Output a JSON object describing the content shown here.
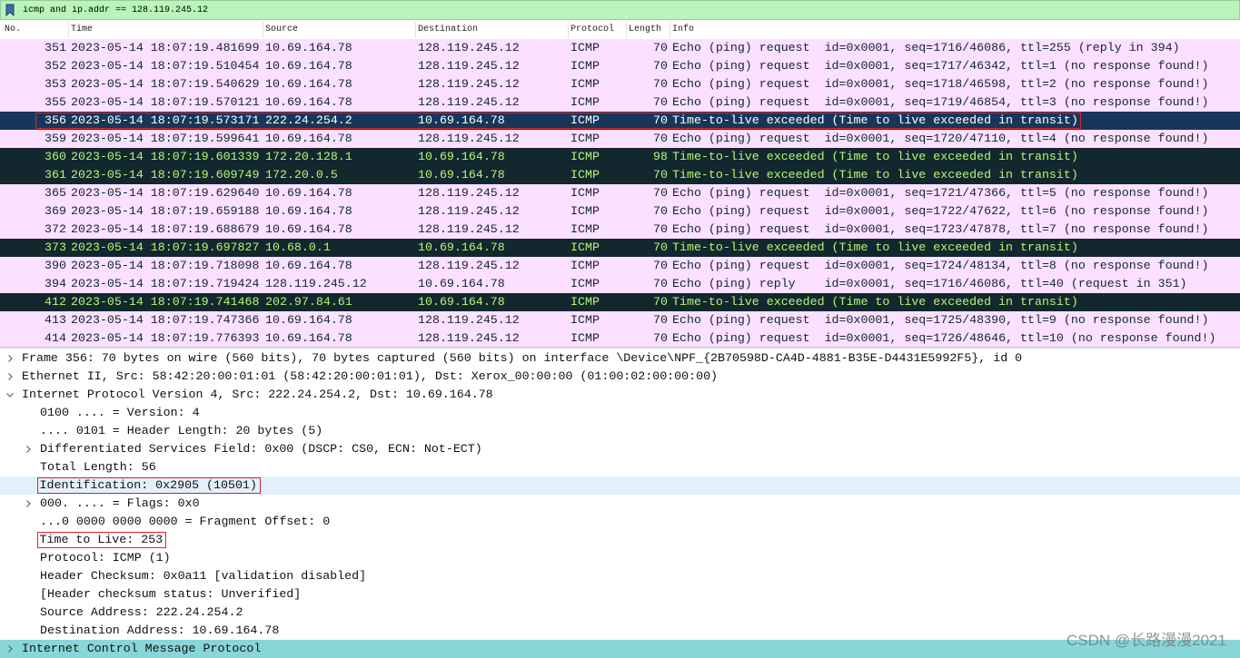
{
  "filter": {
    "icon": "bookmark-icon",
    "value": "icmp and ip.addr == 128.119.245.12",
    "bg": "#b9f5b9"
  },
  "columns": {
    "no": "No.",
    "time": "Time",
    "source": "Source",
    "destination": "Destination",
    "protocol": "Protocol",
    "length": "Length",
    "info": "Info"
  },
  "coloring_rules": {
    "icmp": {
      "bg": "#fce0ff",
      "fg": "#12272e"
    },
    "icmp_errors": {
      "bg": "#12272e",
      "fg": "#b7f774"
    },
    "selected": {
      "bg": "#18365a",
      "fg": "#ffffff"
    }
  },
  "packets": [
    {
      "no": "351",
      "time": "2023-05-14 18:07:19.481699",
      "source": "10.69.164.78",
      "destination": "128.119.245.12",
      "protocol": "ICMP",
      "length": "70",
      "info": "Echo (ping) request  id=0x0001, seq=1716/46086, ttl=255 (reply in 394)",
      "error": false
    },
    {
      "no": "352",
      "time": "2023-05-14 18:07:19.510454",
      "source": "10.69.164.78",
      "destination": "128.119.245.12",
      "protocol": "ICMP",
      "length": "70",
      "info": "Echo (ping) request  id=0x0001, seq=1717/46342, ttl=1 (no response found!)",
      "error": false
    },
    {
      "no": "353",
      "time": "2023-05-14 18:07:19.540629",
      "source": "10.69.164.78",
      "destination": "128.119.245.12",
      "protocol": "ICMP",
      "length": "70",
      "info": "Echo (ping) request  id=0x0001, seq=1718/46598, ttl=2 (no response found!)",
      "error": false
    },
    {
      "no": "355",
      "time": "2023-05-14 18:07:19.570121",
      "source": "10.69.164.78",
      "destination": "128.119.245.12",
      "protocol": "ICMP",
      "length": "70",
      "info": "Echo (ping) request  id=0x0001, seq=1719/46854, ttl=3 (no response found!)",
      "error": false
    },
    {
      "no": "356",
      "time": "2023-05-14 18:07:19.573171",
      "source": "222.24.254.2",
      "destination": "10.69.164.78",
      "protocol": "ICMP",
      "length": "70",
      "info": "Time-to-live exceeded (Time to live exceeded in transit)",
      "error": true,
      "selected": true,
      "boxed": true
    },
    {
      "no": "359",
      "time": "2023-05-14 18:07:19.599641",
      "source": "10.69.164.78",
      "destination": "128.119.245.12",
      "protocol": "ICMP",
      "length": "70",
      "info": "Echo (ping) request  id=0x0001, seq=1720/47110, ttl=4 (no response found!)",
      "error": false
    },
    {
      "no": "360",
      "time": "2023-05-14 18:07:19.601339",
      "source": "172.20.128.1",
      "destination": "10.69.164.78",
      "protocol": "ICMP",
      "length": "98",
      "info": "Time-to-live exceeded (Time to live exceeded in transit)",
      "error": true
    },
    {
      "no": "361",
      "time": "2023-05-14 18:07:19.609749",
      "source": "172.20.0.5",
      "destination": "10.69.164.78",
      "protocol": "ICMP",
      "length": "70",
      "info": "Time-to-live exceeded (Time to live exceeded in transit)",
      "error": true
    },
    {
      "no": "365",
      "time": "2023-05-14 18:07:19.629640",
      "source": "10.69.164.78",
      "destination": "128.119.245.12",
      "protocol": "ICMP",
      "length": "70",
      "info": "Echo (ping) request  id=0x0001, seq=1721/47366, ttl=5 (no response found!)",
      "error": false
    },
    {
      "no": "369",
      "time": "2023-05-14 18:07:19.659188",
      "source": "10.69.164.78",
      "destination": "128.119.245.12",
      "protocol": "ICMP",
      "length": "70",
      "info": "Echo (ping) request  id=0x0001, seq=1722/47622, ttl=6 (no response found!)",
      "error": false
    },
    {
      "no": "372",
      "time": "2023-05-14 18:07:19.688679",
      "source": "10.69.164.78",
      "destination": "128.119.245.12",
      "protocol": "ICMP",
      "length": "70",
      "info": "Echo (ping) request  id=0x0001, seq=1723/47878, ttl=7 (no response found!)",
      "error": false
    },
    {
      "no": "373",
      "time": "2023-05-14 18:07:19.697827",
      "source": "10.68.0.1",
      "destination": "10.69.164.78",
      "protocol": "ICMP",
      "length": "70",
      "info": "Time-to-live exceeded (Time to live exceeded in transit)",
      "error": true
    },
    {
      "no": "390",
      "time": "2023-05-14 18:07:19.718098",
      "source": "10.69.164.78",
      "destination": "128.119.245.12",
      "protocol": "ICMP",
      "length": "70",
      "info": "Echo (ping) request  id=0x0001, seq=1724/48134, ttl=8 (no response found!)",
      "error": false
    },
    {
      "no": "394",
      "time": "2023-05-14 18:07:19.719424",
      "source": "128.119.245.12",
      "destination": "10.69.164.78",
      "protocol": "ICMP",
      "length": "70",
      "info": "Echo (ping) reply    id=0x0001, seq=1716/46086, ttl=40 (request in 351)",
      "error": false
    },
    {
      "no": "412",
      "time": "2023-05-14 18:07:19.741468",
      "source": "202.97.84.61",
      "destination": "10.69.164.78",
      "protocol": "ICMP",
      "length": "70",
      "info": "Time-to-live exceeded (Time to live exceeded in transit)",
      "error": true
    },
    {
      "no": "413",
      "time": "2023-05-14 18:07:19.747366",
      "source": "10.69.164.78",
      "destination": "128.119.245.12",
      "protocol": "ICMP",
      "length": "70",
      "info": "Echo (ping) request  id=0x0001, seq=1725/48390, ttl=9 (no response found!)",
      "error": false
    },
    {
      "no": "414",
      "time": "2023-05-14 18:07:19.776393",
      "source": "10.69.164.78",
      "destination": "128.119.245.12",
      "protocol": "ICMP",
      "length": "70",
      "info": "Echo (ping) request  id=0x0001, seq=1726/48646, ttl=10 (no response found!)",
      "error": false
    }
  ],
  "details": [
    {
      "label": "Frame 356: 70 bytes on wire (560 bits), 70 bytes captured (560 bits) on interface \\Device\\NPF_{2B70598D-CA4D-4881-B35E-D4431E5992F5}, id 0",
      "expandable": true,
      "expanded": false
    },
    {
      "label": "Ethernet II, Src: 58:42:20:00:01:01 (58:42:20:00:01:01), Dst: Xerox_00:00:00 (01:00:02:00:00:00)",
      "expandable": true,
      "expanded": false
    },
    {
      "label": "Internet Protocol Version 4, Src: 222.24.254.2, Dst: 10.69.164.78",
      "expandable": true,
      "expanded": true,
      "children": [
        {
          "label": "0100 .... = Version: 4"
        },
        {
          "label": ".... 0101 = Header Length: 20 bytes (5)"
        },
        {
          "label": "Differentiated Services Field: 0x00 (DSCP: CS0, ECN: Not-ECT)",
          "expandable": true,
          "expanded": false
        },
        {
          "label": "Total Length: 56"
        },
        {
          "label": "Identification: 0x2905 (10501)",
          "boxed": true,
          "row_highlight": "#e3f0fb"
        },
        {
          "label": "000. .... = Flags: 0x0",
          "expandable": true,
          "expanded": false
        },
        {
          "label": "...0 0000 0000 0000 = Fragment Offset: 0"
        },
        {
          "label": "Time to Live: 253",
          "boxed": true
        },
        {
          "label": "Protocol: ICMP (1)"
        },
        {
          "label": "Header Checksum: 0x0a11 [validation disabled]"
        },
        {
          "label": "[Header checksum status: Unverified]"
        },
        {
          "label": "Source Address: 222.24.254.2"
        },
        {
          "label": "Destination Address: 10.69.164.78"
        }
      ]
    },
    {
      "label": "Internet Control Message Protocol",
      "expandable": true,
      "expanded": false,
      "row_highlight": "#88d6d8"
    }
  ],
  "watermark": "CSDN @长路漫漫2021"
}
